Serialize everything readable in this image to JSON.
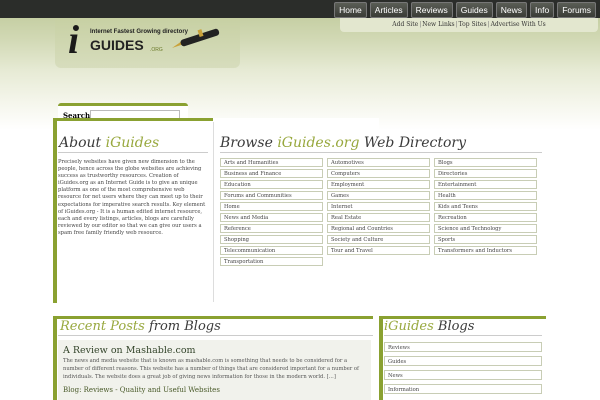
{
  "nav": [
    "Home",
    "Articles",
    "Reviews",
    "Guides",
    "News",
    "Info",
    "Forums"
  ],
  "subnav": [
    "Add Site",
    "New Links",
    "Top Sites",
    "Advertise With Us"
  ],
  "logo": {
    "letter": "i",
    "tagline": "Internet Fastest Growing directory",
    "name": "GUIDES",
    "domain": ".ORG"
  },
  "search": {
    "label": "Search:",
    "value": ""
  },
  "about": {
    "title_prefix": "About ",
    "title_accent": "iGuides",
    "text": "Precisely websites have given new dimension to the people, hence across the globe websites are achieving success as trustworthy resources. Creation of iGuides.org as an Internet Guide is to give an unique platform as one of the most comprehensive web resource for net users where they can meet up to their expectations for imperative search results. Key element of iGuides.org - It is a human edited internet resource, each and every listings, articles, blogs are carefully reviewed by our editor so that we can give our users a spam free family friendly web resource."
  },
  "browse": {
    "title_prefix": "Browse ",
    "title_accent": "iGuides.org",
    "title_suffix": " Web Directory",
    "col1": [
      "Arts and Humanities",
      "Business and Finance",
      "Education",
      "Forums and Communities",
      "Home",
      "News and Media",
      "Reference",
      "Shopping",
      "Telecommunication",
      "Transportation"
    ],
    "col2": [
      "Automotives",
      "Computers",
      "Employment",
      "Games",
      "Internet",
      "Real Estate",
      "Regional and Countries",
      "Society and Culture",
      "Tour and Travel"
    ],
    "col3": [
      "Blogs",
      "Directories",
      "Entertainment",
      "Health",
      "Kids and Teens",
      "Recreation",
      "Science and Technology",
      "Sports",
      "Transformers and Inductors"
    ]
  },
  "recent": {
    "title_prefix": "Recent Posts",
    "title_suffix": " from Blogs",
    "post_title": "A Review on Mashable.com",
    "post_text": "The news and media website that is known as mashable.com is something that needs to be considered for a number of different reasons.  This website has a number of things that are considered important for a number of individuals.  The website does a great job of giving news information for those in the modern world.  […]",
    "post_category": "Blog: Reviews - Quality and Useful Websites"
  },
  "iguides_blogs": {
    "title_prefix": "iGuides",
    "title_suffix": " Blogs",
    "items": [
      "Reviews",
      "Guides",
      "News",
      "Information"
    ]
  }
}
